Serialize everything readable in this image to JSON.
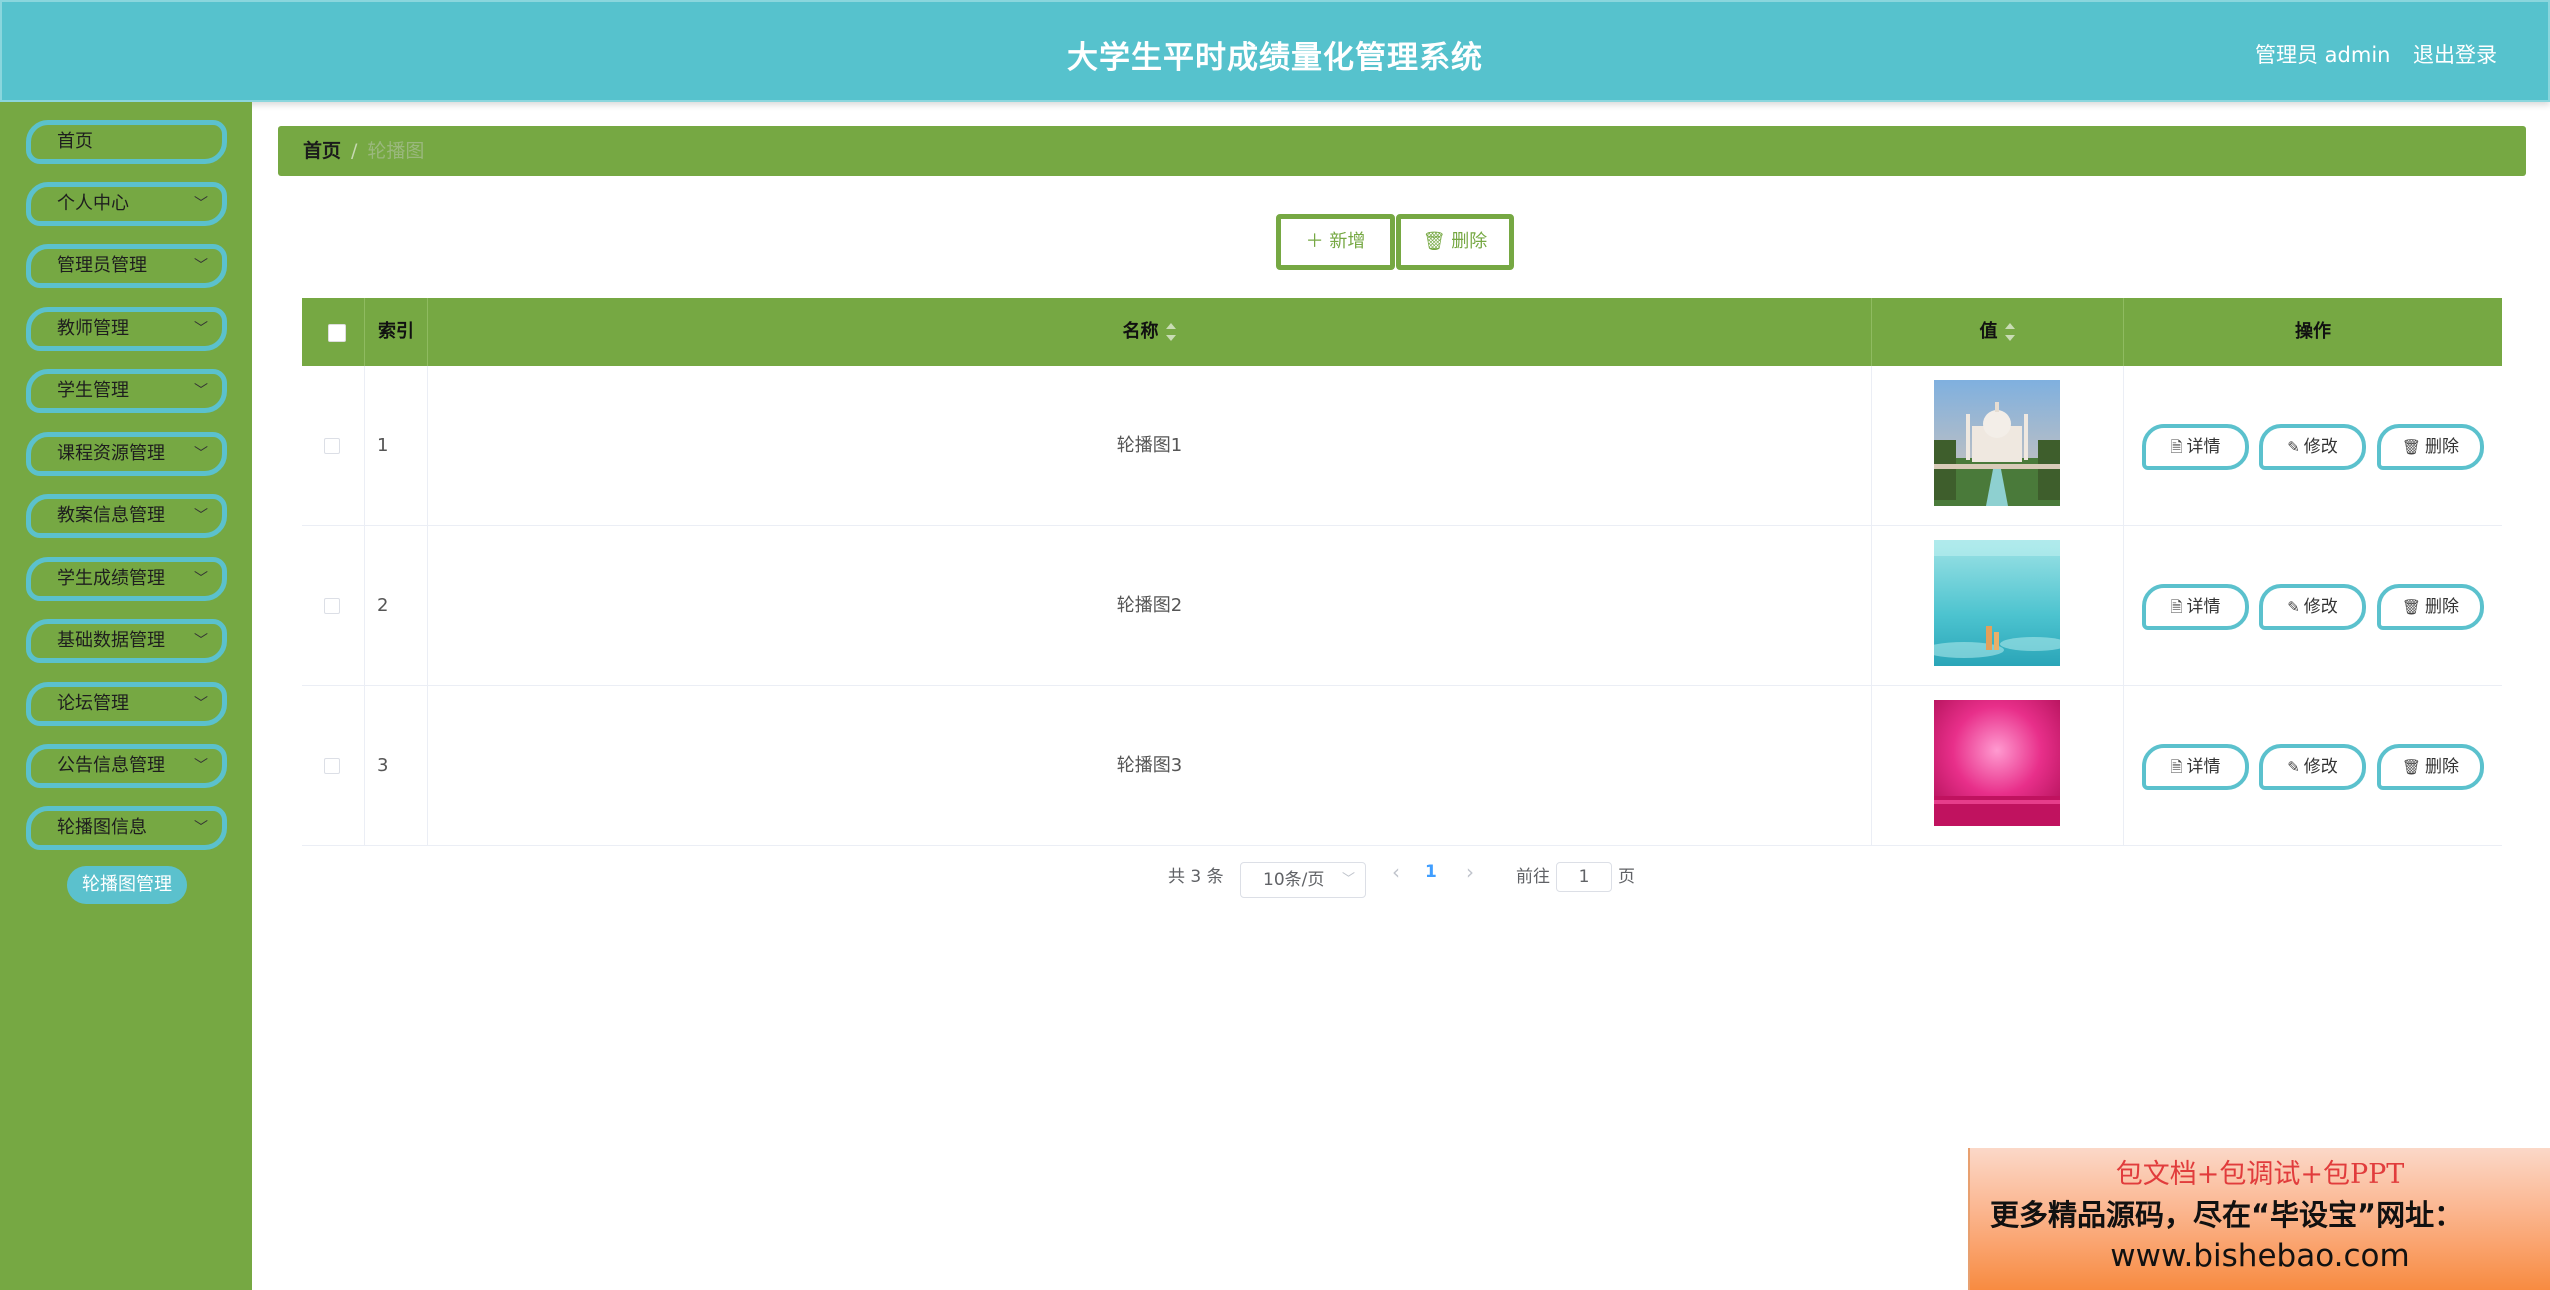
{
  "header": {
    "title": "大学生平时成绩量化管理系统",
    "user": "管理员 admin",
    "logout": "退出登录"
  },
  "sidebar": {
    "items": [
      {
        "label": "首页"
      },
      {
        "label": "个人中心"
      },
      {
        "label": "管理员管理"
      },
      {
        "label": "教师管理"
      },
      {
        "label": "学生管理"
      },
      {
        "label": "课程资源管理"
      },
      {
        "label": "教案信息管理"
      },
      {
        "label": "学生成绩管理"
      },
      {
        "label": "基础数据管理"
      },
      {
        "label": "论坛管理"
      },
      {
        "label": "公告信息管理"
      },
      {
        "label": "轮播图信息"
      }
    ],
    "sub_item": "轮播图管理"
  },
  "breadcrumb": {
    "home": "首页",
    "separator": "/",
    "current": "轮播图"
  },
  "actions": {
    "add": "新增",
    "delete": "删除"
  },
  "table": {
    "headers": {
      "index": "索引",
      "name": "名称",
      "value": "值",
      "ops": "操作"
    },
    "rows": [
      {
        "index": "1",
        "name": "轮播图1",
        "image": "taj-mahal-photo"
      },
      {
        "index": "2",
        "name": "轮播图2",
        "image": "underwater-photo"
      },
      {
        "index": "3",
        "name": "轮播图3",
        "image": "pink-stage-photo"
      }
    ],
    "ops": {
      "detail": "详情",
      "edit": "修改",
      "delete": "删除"
    }
  },
  "pagination": {
    "total": "共 3 条",
    "page_size": "10条/页",
    "current_page": "1",
    "goto_label": "前往",
    "goto_value": "1",
    "page_suffix": "页"
  },
  "promo": {
    "line1": "包文档+包调试+包PPT",
    "line2": "更多精品源码，尽在“毕设宝”网址：",
    "line3": "www.bishebao.com"
  }
}
